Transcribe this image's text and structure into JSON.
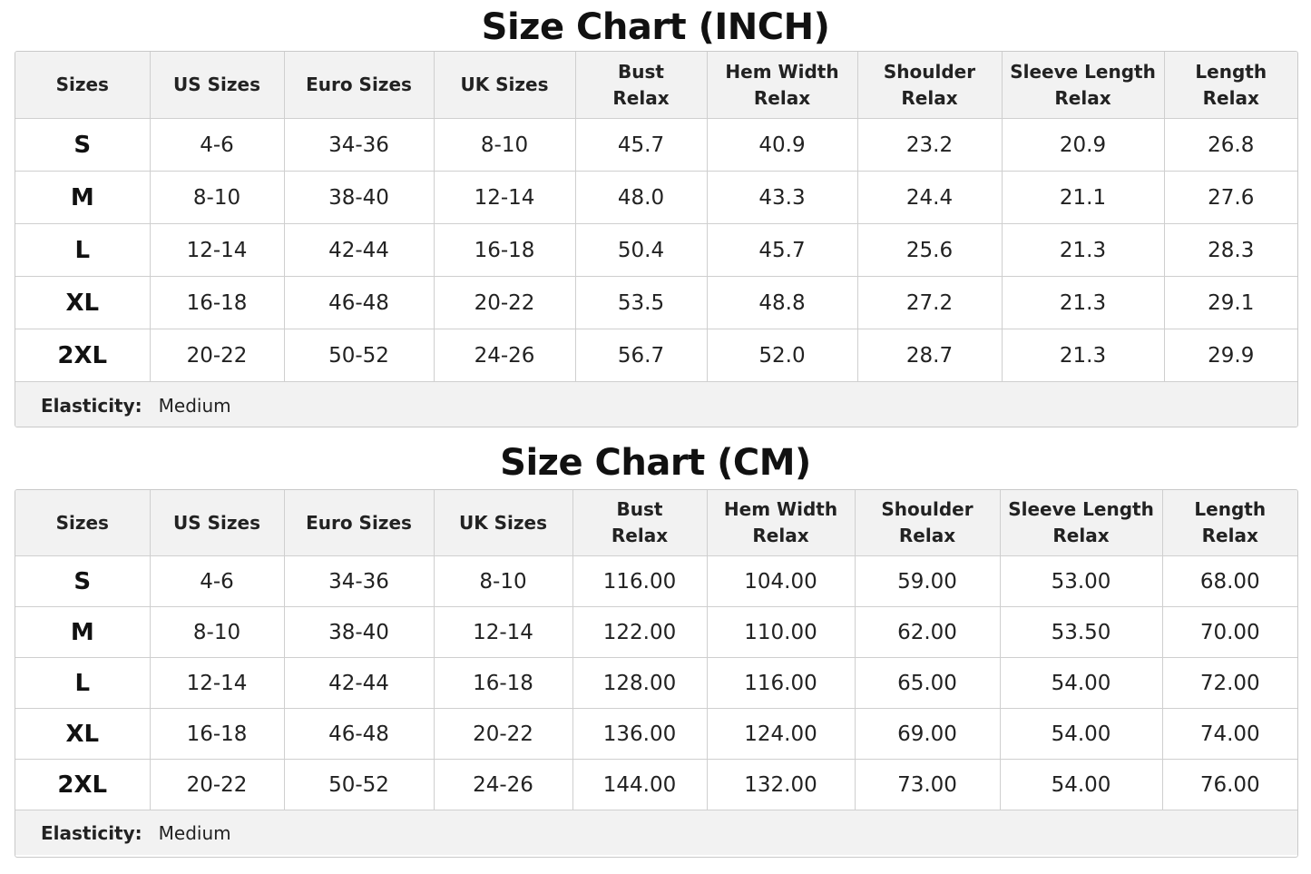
{
  "inch_chart": {
    "title": "Size Chart (INCH)",
    "headers": [
      [
        "Sizes"
      ],
      [
        "US Sizes"
      ],
      [
        "Euro Sizes"
      ],
      [
        "UK Sizes"
      ],
      [
        "Bust",
        "Relax"
      ],
      [
        "Hem Width",
        "Relax"
      ],
      [
        "Shoulder",
        "Relax"
      ],
      [
        "Sleeve Length",
        "Relax"
      ],
      [
        "Length",
        "Relax"
      ]
    ],
    "rows": [
      [
        "S",
        "4-6",
        "34-36",
        "8-10",
        "45.7",
        "40.9",
        "23.2",
        "20.9",
        "26.8"
      ],
      [
        "M",
        "8-10",
        "38-40",
        "12-14",
        "48.0",
        "43.3",
        "24.4",
        "21.1",
        "27.6"
      ],
      [
        "L",
        "12-14",
        "42-44",
        "16-18",
        "50.4",
        "45.7",
        "25.6",
        "21.3",
        "28.3"
      ],
      [
        "XL",
        "16-18",
        "46-48",
        "20-22",
        "53.5",
        "48.8",
        "27.2",
        "21.3",
        "29.1"
      ],
      [
        "2XL",
        "20-22",
        "50-52",
        "24-26",
        "56.7",
        "52.0",
        "28.7",
        "21.3",
        "29.9"
      ]
    ],
    "elasticity_label": "Elasticity:",
    "elasticity_value": "Medium"
  },
  "cm_chart": {
    "title": "Size Chart (CM)",
    "headers": [
      [
        "Sizes"
      ],
      [
        "US Sizes"
      ],
      [
        "Euro Sizes"
      ],
      [
        "UK Sizes"
      ],
      [
        "Bust",
        "Relax"
      ],
      [
        "Hem Width",
        "Relax"
      ],
      [
        "Shoulder",
        "Relax"
      ],
      [
        "Sleeve Length",
        "Relax"
      ],
      [
        "Length",
        "Relax"
      ]
    ],
    "rows": [
      [
        "S",
        "4-6",
        "34-36",
        "8-10",
        "116.00",
        "104.00",
        "59.00",
        "53.00",
        "68.00"
      ],
      [
        "M",
        "8-10",
        "38-40",
        "12-14",
        "122.00",
        "110.00",
        "62.00",
        "53.50",
        "70.00"
      ],
      [
        "L",
        "12-14",
        "42-44",
        "16-18",
        "128.00",
        "116.00",
        "65.00",
        "54.00",
        "72.00"
      ],
      [
        "XL",
        "16-18",
        "46-48",
        "20-22",
        "136.00",
        "124.00",
        "69.00",
        "54.00",
        "74.00"
      ],
      [
        "2XL",
        "20-22",
        "50-52",
        "24-26",
        "144.00",
        "132.00",
        "73.00",
        "54.00",
        "76.00"
      ]
    ],
    "elasticity_label": "Elasticity:",
    "elasticity_value": "Medium"
  }
}
